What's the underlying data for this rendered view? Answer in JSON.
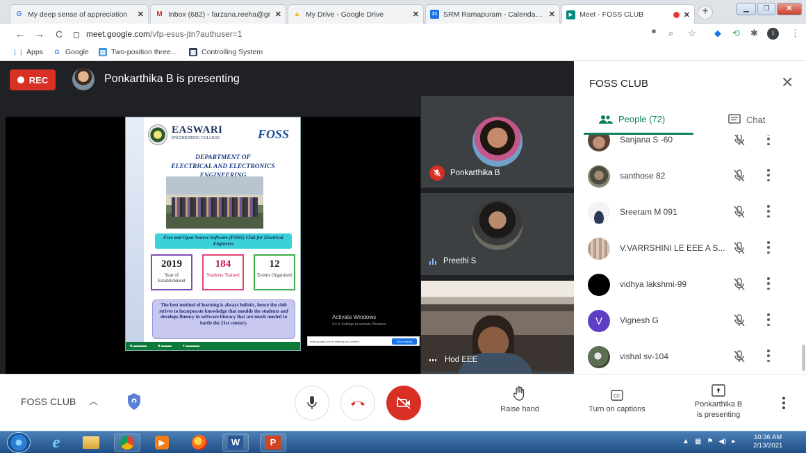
{
  "browser": {
    "tabs": [
      {
        "title": "My deep sense of appreciation",
        "favicon": "G",
        "color": "#4285f4"
      },
      {
        "title": "Inbox (682) - farzana.reeha@gr",
        "favicon": "M",
        "color": "#d93025"
      },
      {
        "title": "My Drive - Google Drive",
        "favicon": "▲",
        "color": "#fbbc04"
      },
      {
        "title": "SRM Ramapuram - Calendar - S",
        "favicon": "31",
        "color": "#1a73e8"
      },
      {
        "title": "Meet - FOSS CLUB",
        "favicon": "▶",
        "color": "#00897b"
      }
    ],
    "url_host": "meet.google.com",
    "url_path": "/vfp-esus-jtn?authuser=1",
    "bookmarks": [
      {
        "label": "Apps",
        "icon": "apps-grid-icon"
      },
      {
        "label": "Google",
        "icon": "google-g-icon"
      },
      {
        "label": "Two-position three...",
        "icon": "bookmark-blue-icon"
      },
      {
        "label": "Controlling System",
        "icon": "bookmark-dark-icon"
      }
    ]
  },
  "stage": {
    "rec_label": "REC",
    "presenting_text": "Ponkarthika B is presenting"
  },
  "slide": {
    "college": "EASWARI",
    "college_sub": "ENGINEERING COLLEGE",
    "foss_logo": "FOSS",
    "dept_line1": "DEPARTMENT OF",
    "dept_line2": "ELECTRICAL AND ELECTRONICS ENGINEERING",
    "club_banner": "Free and Open Source Software (FOSS) Club for Electrical Engineers",
    "stats": [
      {
        "num": "2019",
        "label": "Year of Establishment",
        "color": "#7b4fb8"
      },
      {
        "num": "184",
        "label": "Students Trained",
        "color": "#e0457b"
      },
      {
        "num": "12",
        "label": "Events Organized",
        "color": "#3fae4a"
      }
    ],
    "quote": "The best method of learning is always holistic, hence the club strives to incorporate knowledge that moulds the students and develops fluency in software literacy that are much needed to battle the 21st century."
  },
  "overlay": {
    "activate_title": "Activate Windows",
    "activate_sub": "Go to Settings to activate Windows.",
    "share_text": "meet.google.com is sharing your screen.",
    "share_button": "Stop sharing"
  },
  "tiles": [
    {
      "name": "Ponkarthika B",
      "muted": true
    },
    {
      "name": "Preethi S",
      "muted": false
    },
    {
      "name": "Hod EEE",
      "muted": false
    }
  ],
  "panel": {
    "title": "FOSS CLUB",
    "people_tab": "People (72)",
    "chat_tab": "Chat",
    "participants": [
      {
        "name": "Sanjana S -60",
        "initial": "",
        "color": "#8d6e63"
      },
      {
        "name": "santhose 82",
        "initial": "",
        "color": "#6d6d5c"
      },
      {
        "name": "Sreeram M 091",
        "initial": "",
        "color": "#cfd8dc"
      },
      {
        "name": "V.VARRSHINI LE EEE A S...",
        "initial": "",
        "color": "#a1887f"
      },
      {
        "name": "vidhya lakshmi-99",
        "initial": "",
        "color": "#000000"
      },
      {
        "name": "Vignesh G",
        "initial": "V",
        "color": "#5c3fc4"
      },
      {
        "name": "vishal sv-104",
        "initial": "",
        "color": "#5d6f52"
      }
    ]
  },
  "meetbar": {
    "meeting_name": "FOSS CLUB",
    "raise_hand": "Raise hand",
    "captions": "Turn on captions",
    "presenting_line1": "Ponkarthika B",
    "presenting_line2": "is presenting"
  },
  "taskbar": {
    "time": "10:36 AM",
    "date": "2/13/2021"
  }
}
